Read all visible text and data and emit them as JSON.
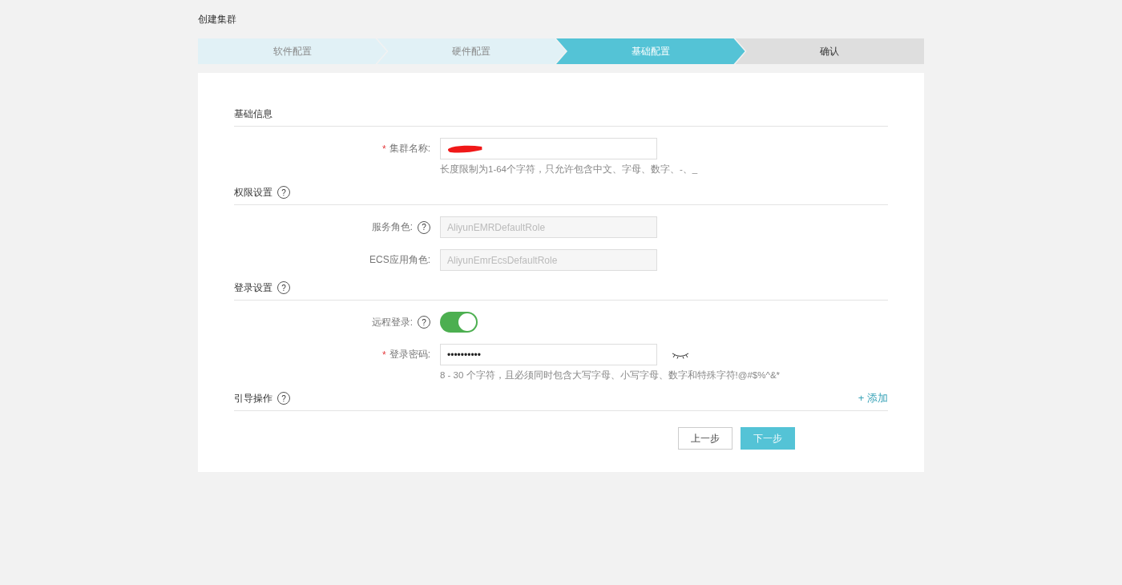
{
  "page_title": "创建集群",
  "steps": [
    {
      "label": "软件配置",
      "completed": true,
      "selected": false
    },
    {
      "label": "硬件配置",
      "completed": true,
      "selected": false
    },
    {
      "label": "基础配置",
      "completed": false,
      "selected": true
    },
    {
      "label": "确认",
      "completed": false,
      "selected": false
    }
  ],
  "sections": [
    {
      "title": "基础信息",
      "fields": [
        {
          "kind": "text",
          "label": "集群名称:",
          "required_mark": "*",
          "redacted": true,
          "hint": "长度限制为1-64个字符，只允许包含中文、字母、数字、-、_"
        }
      ]
    },
    {
      "title": "权限设置",
      "help_icon": "?",
      "fields": [
        {
          "kind": "readonly",
          "label": "服务角色:",
          "help_icon": "?",
          "disabled": true,
          "value": "AliyunEMRDefaultRole"
        },
        {
          "kind": "readonly",
          "label": "ECS应用角色:",
          "disabled": true,
          "value": "AliyunEmrEcsDefaultRole"
        }
      ]
    },
    {
      "title": "登录设置",
      "help_icon": "?",
      "fields": [
        {
          "kind": "switch",
          "label": "远程登录:",
          "help_icon": "?",
          "on": true
        },
        {
          "kind": "password",
          "label": "登录密码:",
          "required_mark": "*",
          "value": "••••••••••",
          "hint": "8 - 30 个字符，且必须同时包含大写字母、小写字母、数字和特殊字符!@#$%^&*"
        }
      ]
    },
    {
      "title": "引导操作",
      "help_icon": "?",
      "action": "+ 添加"
    }
  ],
  "buttons": [
    {
      "label": "上一步",
      "kind": "default"
    },
    {
      "label": "下一步",
      "kind": "primary"
    }
  ]
}
